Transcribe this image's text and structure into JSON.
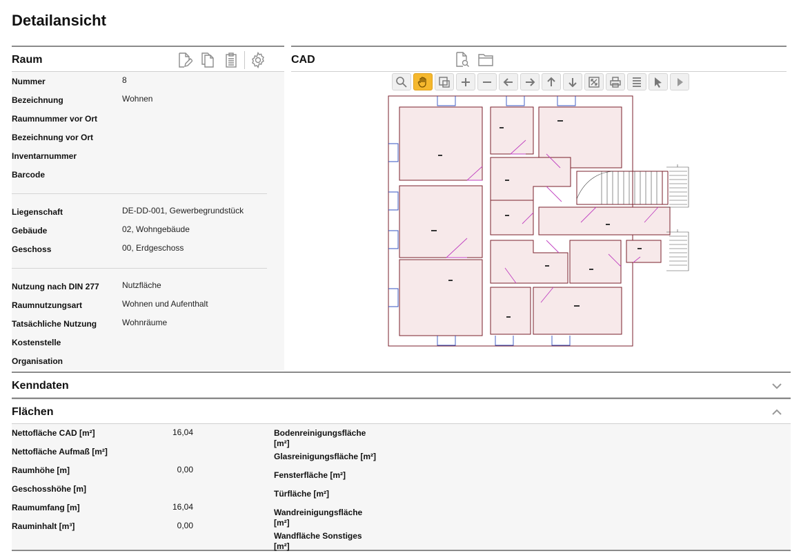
{
  "page": {
    "title": "Detailansicht"
  },
  "raum": {
    "title": "Raum",
    "tools": [
      "edit-icon",
      "copy-icon",
      "clipboard-icon",
      "settings-icon"
    ],
    "fields_group1": [
      {
        "label": "Nummer",
        "value": "8"
      },
      {
        "label": "Bezeichnung",
        "value": "Wohnen"
      },
      {
        "label": "Raumnummer vor Ort",
        "value": ""
      },
      {
        "label": "Bezeichnung vor Ort",
        "value": ""
      },
      {
        "label": "Inventarnummer",
        "value": ""
      },
      {
        "label": "Barcode",
        "value": ""
      }
    ],
    "fields_group2": [
      {
        "label": "Liegenschaft",
        "value": "DE-DD-001, Gewerbegrundstück"
      },
      {
        "label": "Gebäude",
        "value": "02, Wohngebäude"
      },
      {
        "label": "Geschoss",
        "value": "00, Erdgeschoss"
      }
    ],
    "fields_group3": [
      {
        "label": "Nutzung nach DIN 277",
        "value": "Nutzfläche"
      },
      {
        "label": "Raumnutzungsart",
        "value": "Wohnen und Aufenthalt"
      },
      {
        "label": "Tatsächliche Nutzung",
        "value": "Wohnräume"
      },
      {
        "label": "Kostenstelle",
        "value": ""
      },
      {
        "label": "Organisation",
        "value": ""
      }
    ]
  },
  "cad": {
    "title": "CAD",
    "header_tools": [
      "search-document-icon",
      "folder-icon"
    ],
    "toolbar": [
      "zoom-icon",
      "pan-hand-icon",
      "zoom-window-icon",
      "zoom-in-icon",
      "zoom-out-icon",
      "arrow-left-icon",
      "arrow-right-icon",
      "arrow-up-icon",
      "arrow-down-icon",
      "zoom-extents-icon",
      "print-icon",
      "layers-icon",
      "select-pointer-icon",
      "play-icon"
    ],
    "active_tool": "pan-hand-icon",
    "colors": {
      "wall": "#7a1f2b",
      "room_fill": "#f7e9ea",
      "door": "#c040c0",
      "window": "#3050c0"
    }
  },
  "kenndaten": {
    "title": "Kenndaten",
    "state": "collapsed"
  },
  "flaechen": {
    "title": "Flächen",
    "state": "expanded",
    "left": [
      {
        "label": "Nettofläche CAD [m²]",
        "value": "16,04"
      },
      {
        "label": "Nettofläche Aufmaß [m²]",
        "value": ""
      },
      {
        "label": "Raumhöhe [m]",
        "value": "0,00"
      },
      {
        "label": "Geschosshöhe [m]",
        "value": ""
      },
      {
        "label": "Raumumfang [m]",
        "value": "16,04"
      },
      {
        "label": "Rauminhalt [m³]",
        "value": "0,00"
      }
    ],
    "right": [
      {
        "label1": "Bodenreinigungsfläche",
        "label2": "[m²]"
      },
      {
        "label1": "Glasreinigungsfläche [m²]",
        "label2": ""
      },
      {
        "label1": "Fensterfläche [m²]",
        "label2": ""
      },
      {
        "label1": "Türfläche [m²]",
        "label2": ""
      },
      {
        "label1": "Wandreinigungsfläche",
        "label2": "[m²]"
      },
      {
        "label1": "Wandfläche Sonstiges",
        "label2": "[m²]"
      }
    ]
  }
}
